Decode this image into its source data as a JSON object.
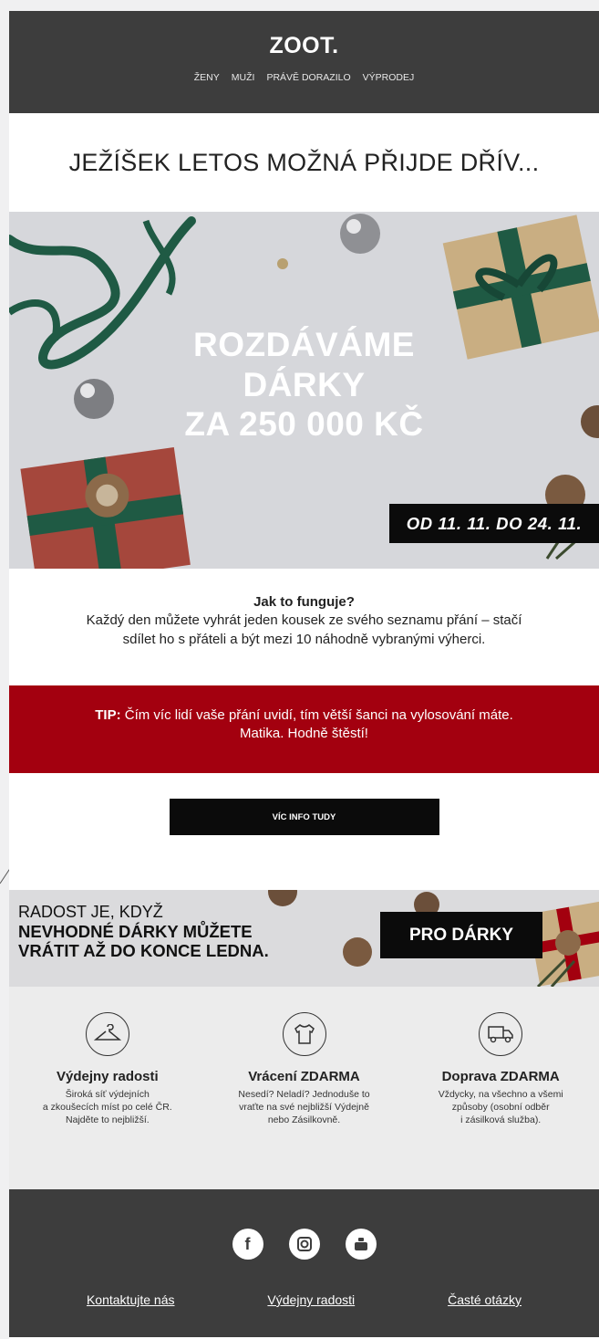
{
  "header": {
    "logo": "ZOOT.",
    "nav": [
      "ŽENY",
      "MUŽI",
      "PRÁVĚ DORAZILO",
      "VÝPRODEJ"
    ]
  },
  "headline": "JEŽÍŠEK LETOS MOŽNÁ PŘIJDE DŘÍV...",
  "hero": {
    "line1": "ROZDÁVÁME",
    "line2": "DÁRKY",
    "line3": "ZA 250 000 KČ",
    "dates": "OD 11. 11. DO 24. 11."
  },
  "how": {
    "title": "Jak to funguje?",
    "line1": "Každý den můžete vyhrát jeden kousek ze svého seznamu přání – stačí",
    "line2": "sdílet ho s přáteli a být mezi 10 náhodně vybranými výherci."
  },
  "tip": {
    "label": "TIP:",
    "line1": " Čím víc lidí vaše přání uvidí, tím větší šanci na vylosování máte.",
    "line2": "Matika. Hodně štěstí!"
  },
  "cta": {
    "label": "VÍC INFO TUDY"
  },
  "banner": {
    "line1": "RADOST JE, KDYŽ",
    "line2": "NEVHODNÉ DÁRKY MŮŽETE",
    "line3": "VRÁTIT AŽ DO KONCE LEDNA.",
    "button": "PRO DÁRKY"
  },
  "features": [
    {
      "icon": "hanger-icon",
      "title": "Výdejny radosti",
      "lines": [
        "Široká síť výdejních",
        "a zkoušecích míst po celé ČR.",
        "Najděte to nejbližší."
      ]
    },
    {
      "icon": "tshirt-icon",
      "title": "Vrácení ZDARMA",
      "lines": [
        "Nesedí? Neladí? Jednoduše to",
        "vraťte na své nejbližší Výdejně",
        "nebo Zásilkovně."
      ]
    },
    {
      "icon": "truck-icon",
      "title": "Doprava ZDARMA",
      "lines": [
        "Vždycky, na všechno a všemi",
        "způsoby (osobní odběr",
        "i zásilková služba)."
      ]
    }
  ],
  "footer": {
    "social": [
      "facebook-icon",
      "instagram-icon",
      "youtube-icon"
    ],
    "links": [
      "Kontaktujte nás",
      "Výdejny radosti",
      "Časté otázky"
    ]
  },
  "colors": {
    "header_bg": "#3d3d3d",
    "tip_red": "#a3000f",
    "ribbon_green": "#1f5a44"
  }
}
